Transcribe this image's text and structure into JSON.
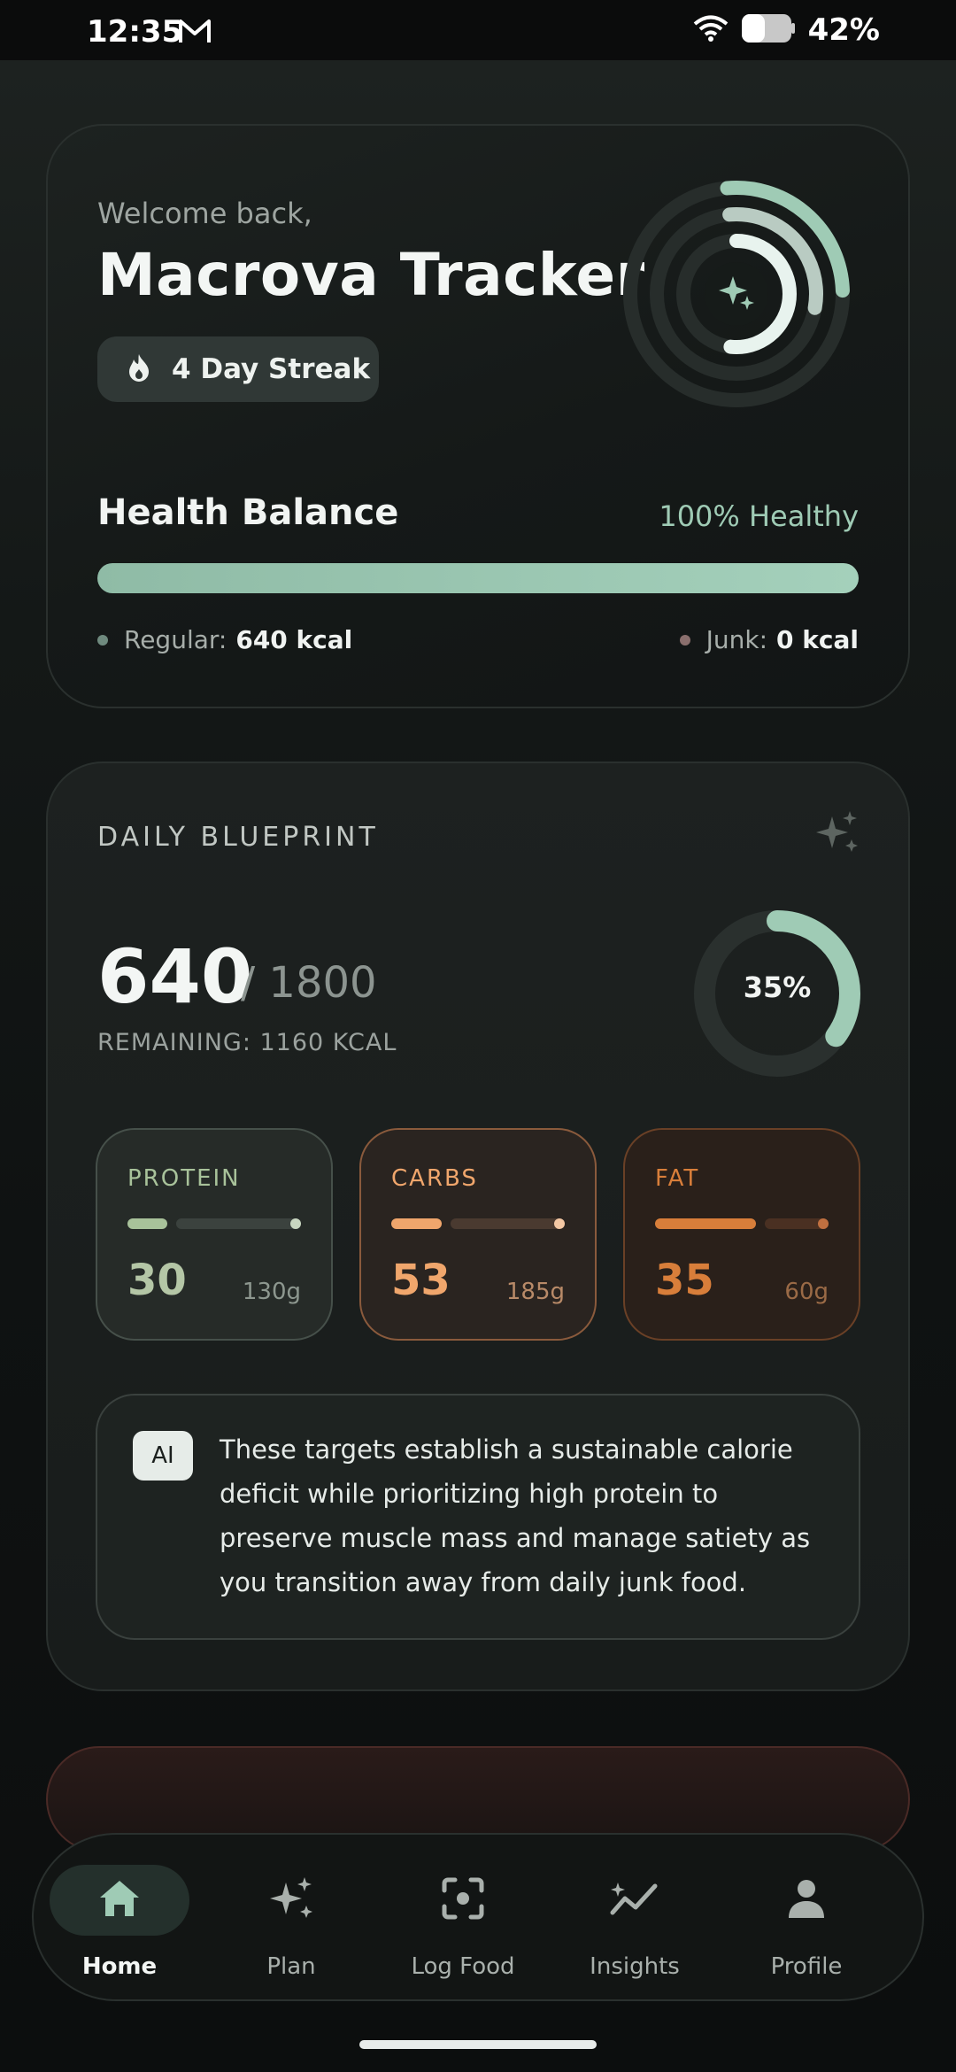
{
  "status_bar": {
    "time": "12:35",
    "battery": "42%"
  },
  "header": {
    "greeting": "Welcome back,",
    "title": "Macrova Tracker",
    "streak": "4 Day Streak"
  },
  "health_balance": {
    "title": "Health Balance",
    "status": "100% Healthy",
    "healthy_fraction": 1.0,
    "regular_label": "Regular:",
    "regular_value": "640 kcal",
    "junk_label": "Junk:",
    "junk_value": "0 kcal"
  },
  "blueprint": {
    "title": "DAILY BLUEPRINT",
    "consumed": "640",
    "target": "/ 1800",
    "remaining": "REMAINING: 1160 KCAL",
    "progress_label": "35%",
    "progress_fraction": 0.35
  },
  "macros": [
    {
      "name": "PROTEIN",
      "value": "30",
      "target": "130g",
      "fraction": 0.23,
      "color": "#a8c29a"
    },
    {
      "name": "CARBS",
      "value": "53",
      "target": "185g",
      "fraction": 0.29,
      "color": "#f0a66c"
    },
    {
      "name": "FAT",
      "value": "35",
      "target": "60g",
      "fraction": 0.58,
      "color": "#d87e3a"
    }
  ],
  "ai": {
    "badge": "AI",
    "message": "These targets establish a sustainable calorie deficit while prioritizing high protein to preserve muscle mass and manage satiety as you transition away from daily junk food."
  },
  "nav": [
    {
      "label": "Home",
      "icon": "home-icon",
      "active": true
    },
    {
      "label": "Plan",
      "icon": "sparkles-icon",
      "active": false
    },
    {
      "label": "Log Food",
      "icon": "scan-icon",
      "active": false
    },
    {
      "label": "Insights",
      "icon": "trend-icon",
      "active": false
    },
    {
      "label": "Profile",
      "icon": "person-icon",
      "active": false
    }
  ],
  "colors": {
    "accent": "#9fcbb5",
    "junk_dot": "#8a6f6d",
    "regular_dot": "#6f8a7e"
  }
}
